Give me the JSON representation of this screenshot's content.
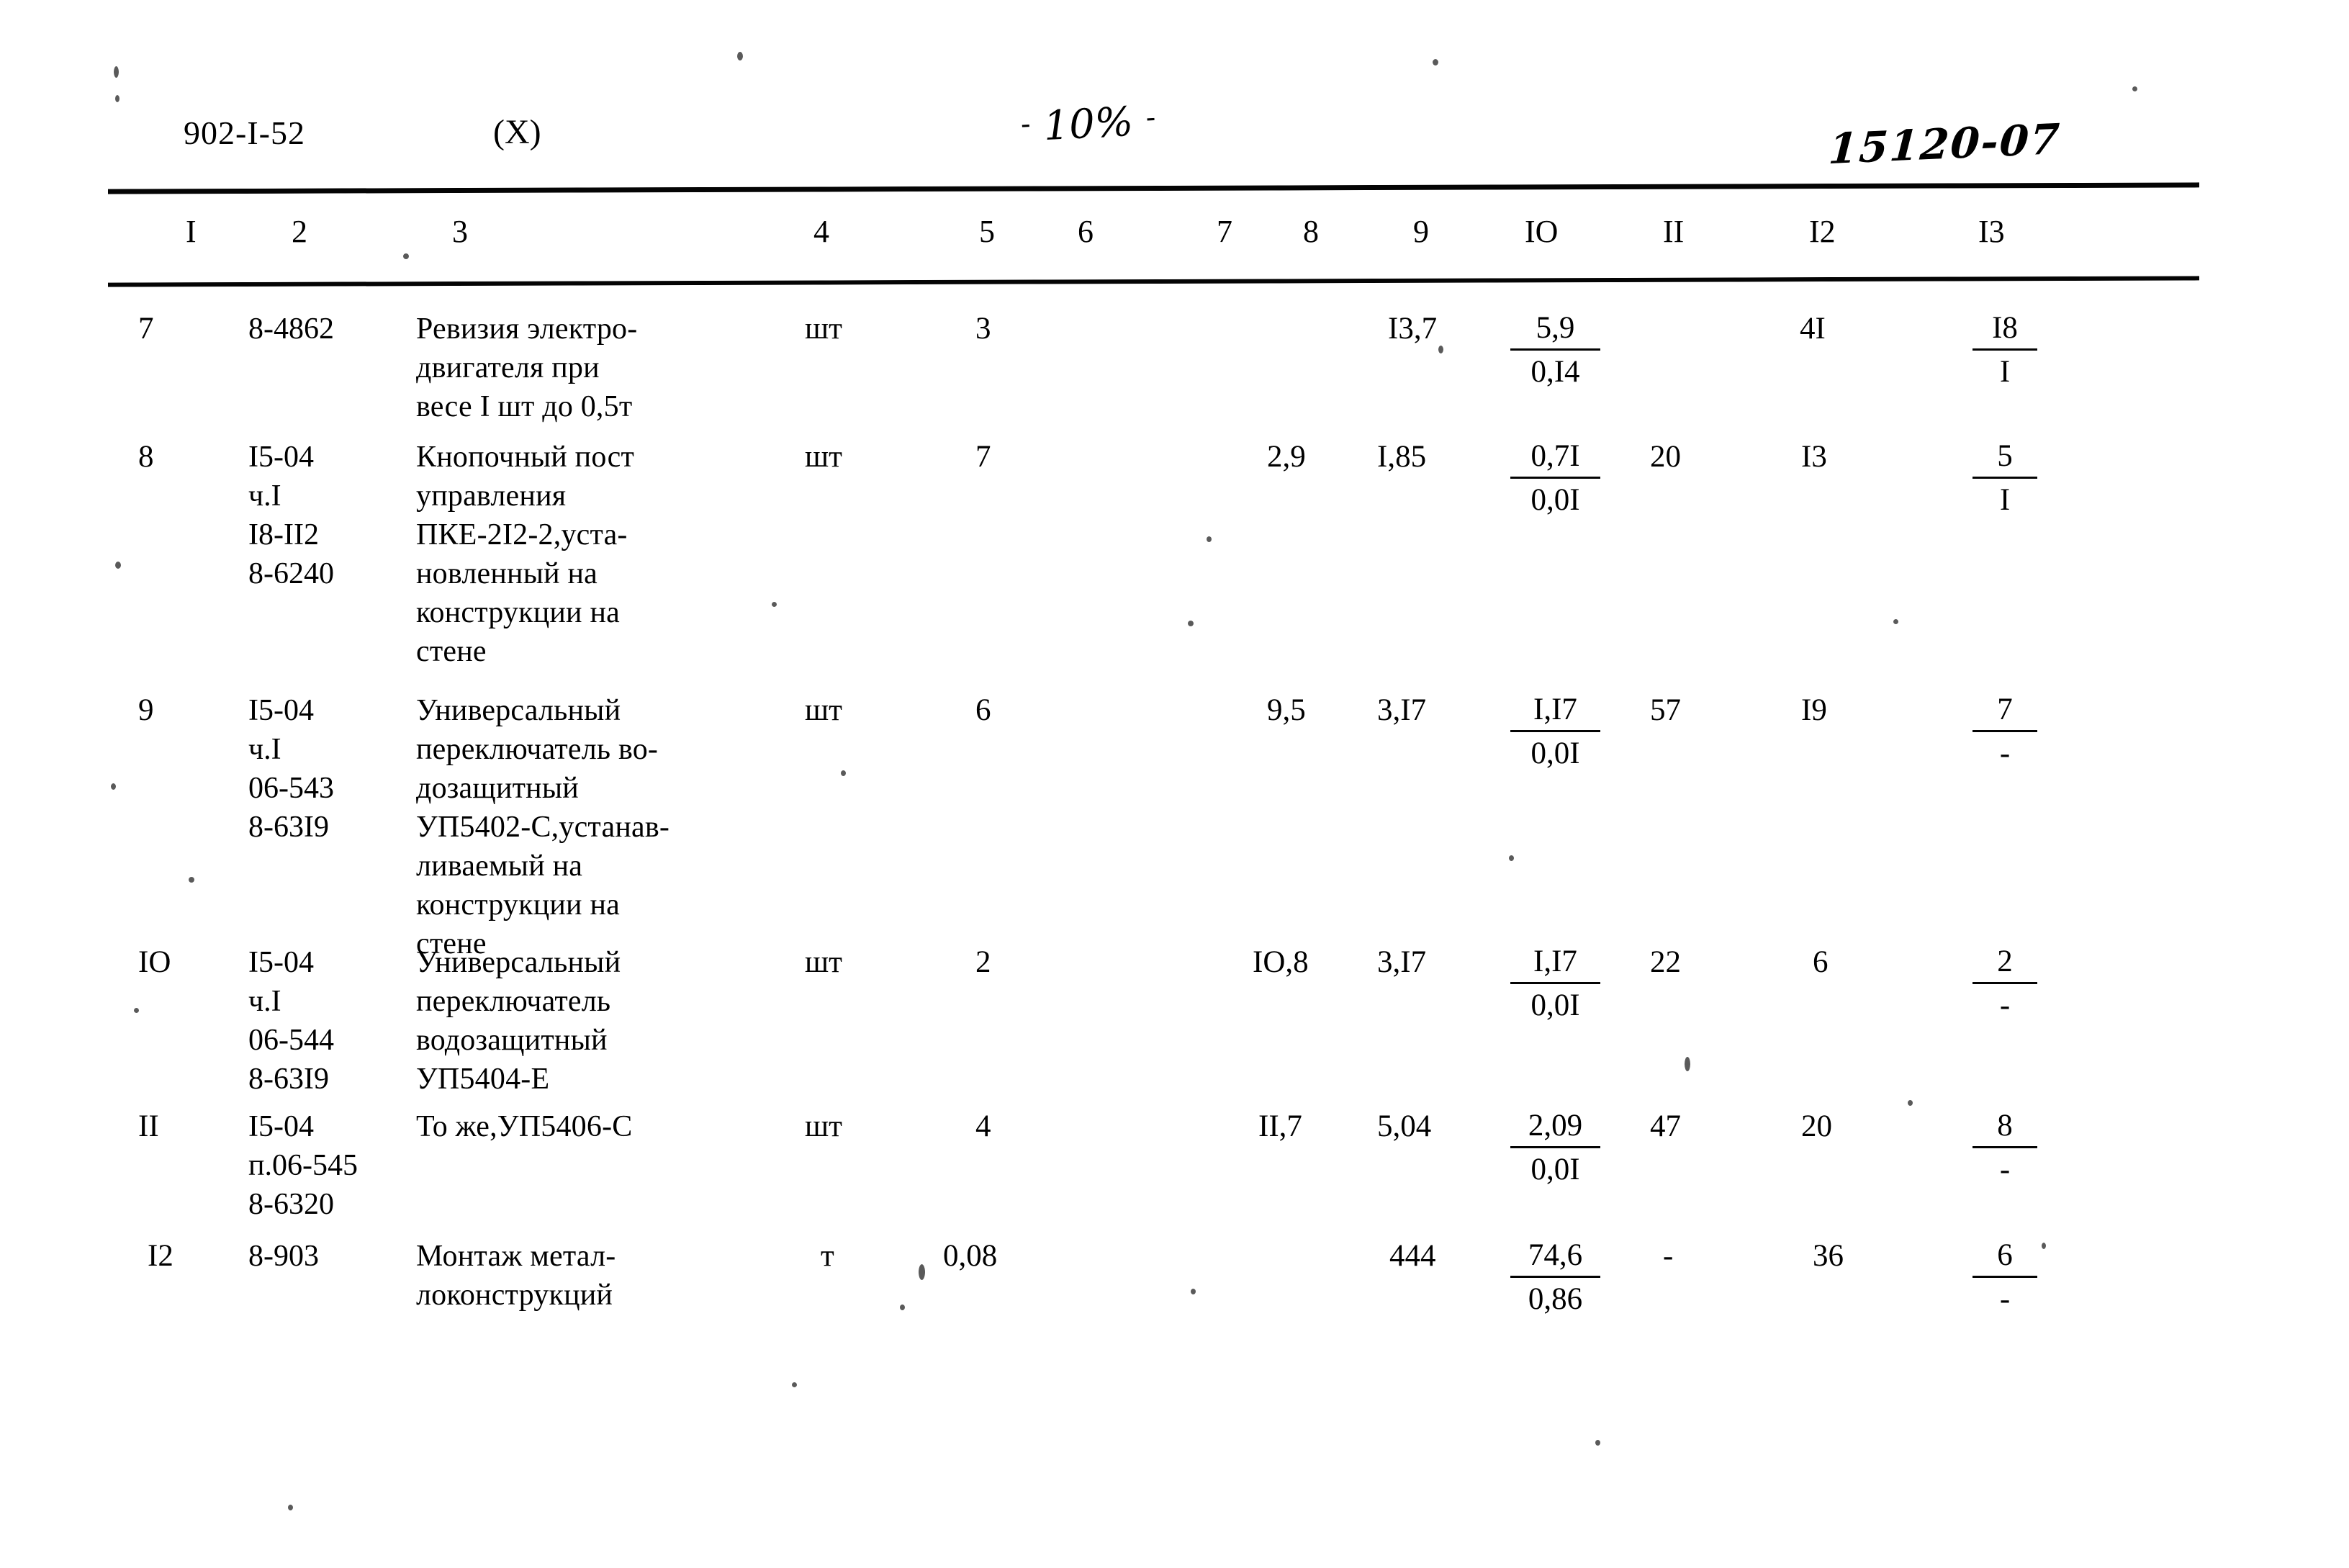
{
  "header": {
    "doc_code": "902-I-52",
    "variant": "(X)",
    "page_number": "10%",
    "page_dash_left": "-",
    "page_dash_right": "-",
    "sheet_code": "15120-07"
  },
  "table": {
    "column_headers": [
      "I",
      "2",
      "3",
      "4",
      "5",
      "6",
      "7",
      "8",
      "9",
      "IO",
      "II",
      "I2",
      "I3"
    ],
    "rows": [
      {
        "n": "7",
        "codes": "8-4862",
        "description": "Ревизия электро-\nдвигателя при\nвесе I шт до 0,5т",
        "unit": "шт",
        "c5": "3",
        "c6": "",
        "c7": "",
        "c8": "",
        "c9": "I3,7",
        "c10_top": "5,9",
        "c10_bot": "0,I4",
        "c11": "",
        "c12": "4I",
        "c13_top": "I8",
        "c13_bot": "I"
      },
      {
        "n": "8",
        "codes": "I5-04\nч.I\nI8-II2\n8-6240",
        "description": "Кнопочный пост\nуправления\nПКЕ-2I2-2,уста-\nновленный на\nконструкции  на\nстене",
        "unit": "шт",
        "c5": "7",
        "c6": "",
        "c7": "",
        "c8": "2,9",
        "c9": "I,85",
        "c10_top": "0,7I",
        "c10_bot": "0,0I",
        "c11": "20",
        "c12": "I3",
        "c13_top": "5",
        "c13_bot": "I"
      },
      {
        "n": "9",
        "codes": "I5-04\nч.I\n06-543\n8-63I9",
        "description": "Универсальный\nпереключатель во-\nдозащитный\nУП5402-С,устанав-\nливаемый  на\nконструкции на\nстене",
        "unit": "шт",
        "c5": "6",
        "c6": "",
        "c7": "",
        "c8": "9,5",
        "c9": "3,I7",
        "c10_top": "I,I7",
        "c10_bot": "0,0I",
        "c11": "57",
        "c12": "I9",
        "c13_top": "7",
        "c13_bot": "-"
      },
      {
        "n": "IO",
        "codes": "I5-04\nч.I\n06-544\n8-63I9",
        "description": "Универсальный\nпереключатель\nводозащитный\nУП5404-Е",
        "unit": "шт",
        "c5": "2",
        "c6": "",
        "c7": "",
        "c8": "IO,8",
        "c9": "3,I7",
        "c10_top": "I,I7",
        "c10_bot": "0,0I",
        "c11": "22",
        "c12": "6",
        "c13_top": "2",
        "c13_bot": "-"
      },
      {
        "n": "II",
        "codes": "I5-04\nп.06-545\n8-6320",
        "description": "То же,УП5406-С",
        "unit": "шт",
        "c5": "4",
        "c6": "",
        "c7": "",
        "c8": "II,7",
        "c9": "5,04",
        "c10_top": "2,09",
        "c10_bot": "0,0I",
        "c11": "47",
        "c12": "20",
        "c13_top": "8",
        "c13_bot": "-"
      },
      {
        "n": "I2",
        "codes": "8-903",
        "description": "Монтаж метал-\nлоконструкций",
        "unit": "т",
        "c5": "0,08",
        "c6": "",
        "c7": "",
        "c8": "",
        "c9": "444",
        "c10_top": "74,6",
        "c10_bot": "0,86",
        "c11": "-",
        "c12": "36",
        "c13_top": "6",
        "c13_bot": "-"
      }
    ]
  }
}
